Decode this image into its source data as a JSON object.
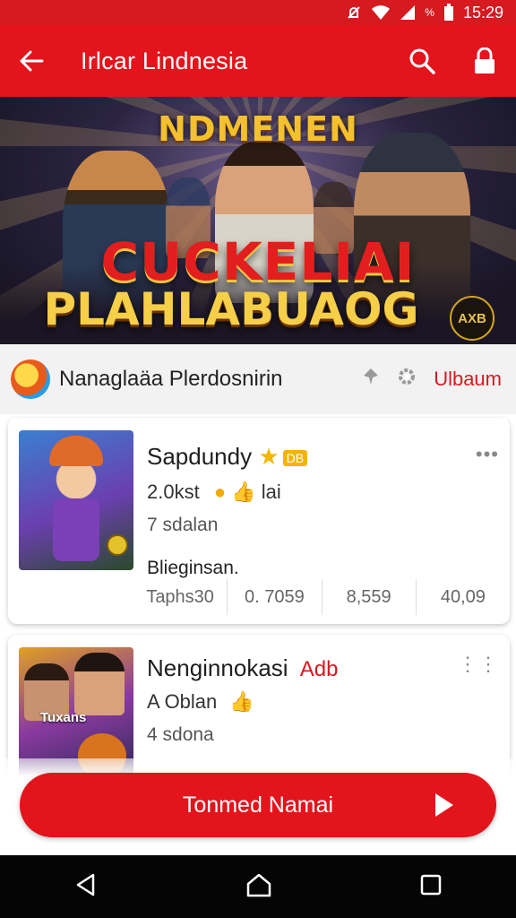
{
  "status": {
    "time": "15:29",
    "battery": "%"
  },
  "app_bar": {
    "title": "Irlcar Lindnesia"
  },
  "banner": {
    "top": "NDMENEN",
    "headline": "CUCKELIAI",
    "subline": "PLAHLABUAOG",
    "badge": "AXB"
  },
  "section": {
    "title": "Nanaglaäa Plerdosnirin",
    "link": "Ulbaum"
  },
  "items": [
    {
      "name": "Sapdundy",
      "tag": "DB",
      "rating": "2.0kst",
      "extra": "lai",
      "downloads": "7 sdalan",
      "desc": "Blieginsan.",
      "stats": [
        "Taphs30",
        "0. 7059",
        "8,559",
        "40,09"
      ]
    },
    {
      "name": "Nenginnokasi",
      "badge": "Adb",
      "rating": "A Oblan",
      "downloads": "4 sdona",
      "thumb_text": "Tuxans"
    }
  ],
  "cta": {
    "label": "Tonmed Namai"
  },
  "colors": {
    "primary": "#e3141c",
    "accent": "#f2b705"
  },
  "icons": [
    "back-arrow-icon",
    "search-icon",
    "lock-icon",
    "pin-icon",
    "settings-icon",
    "more-icon",
    "play-icon",
    "nav-back-icon",
    "nav-home-icon",
    "nav-recents-icon"
  ]
}
